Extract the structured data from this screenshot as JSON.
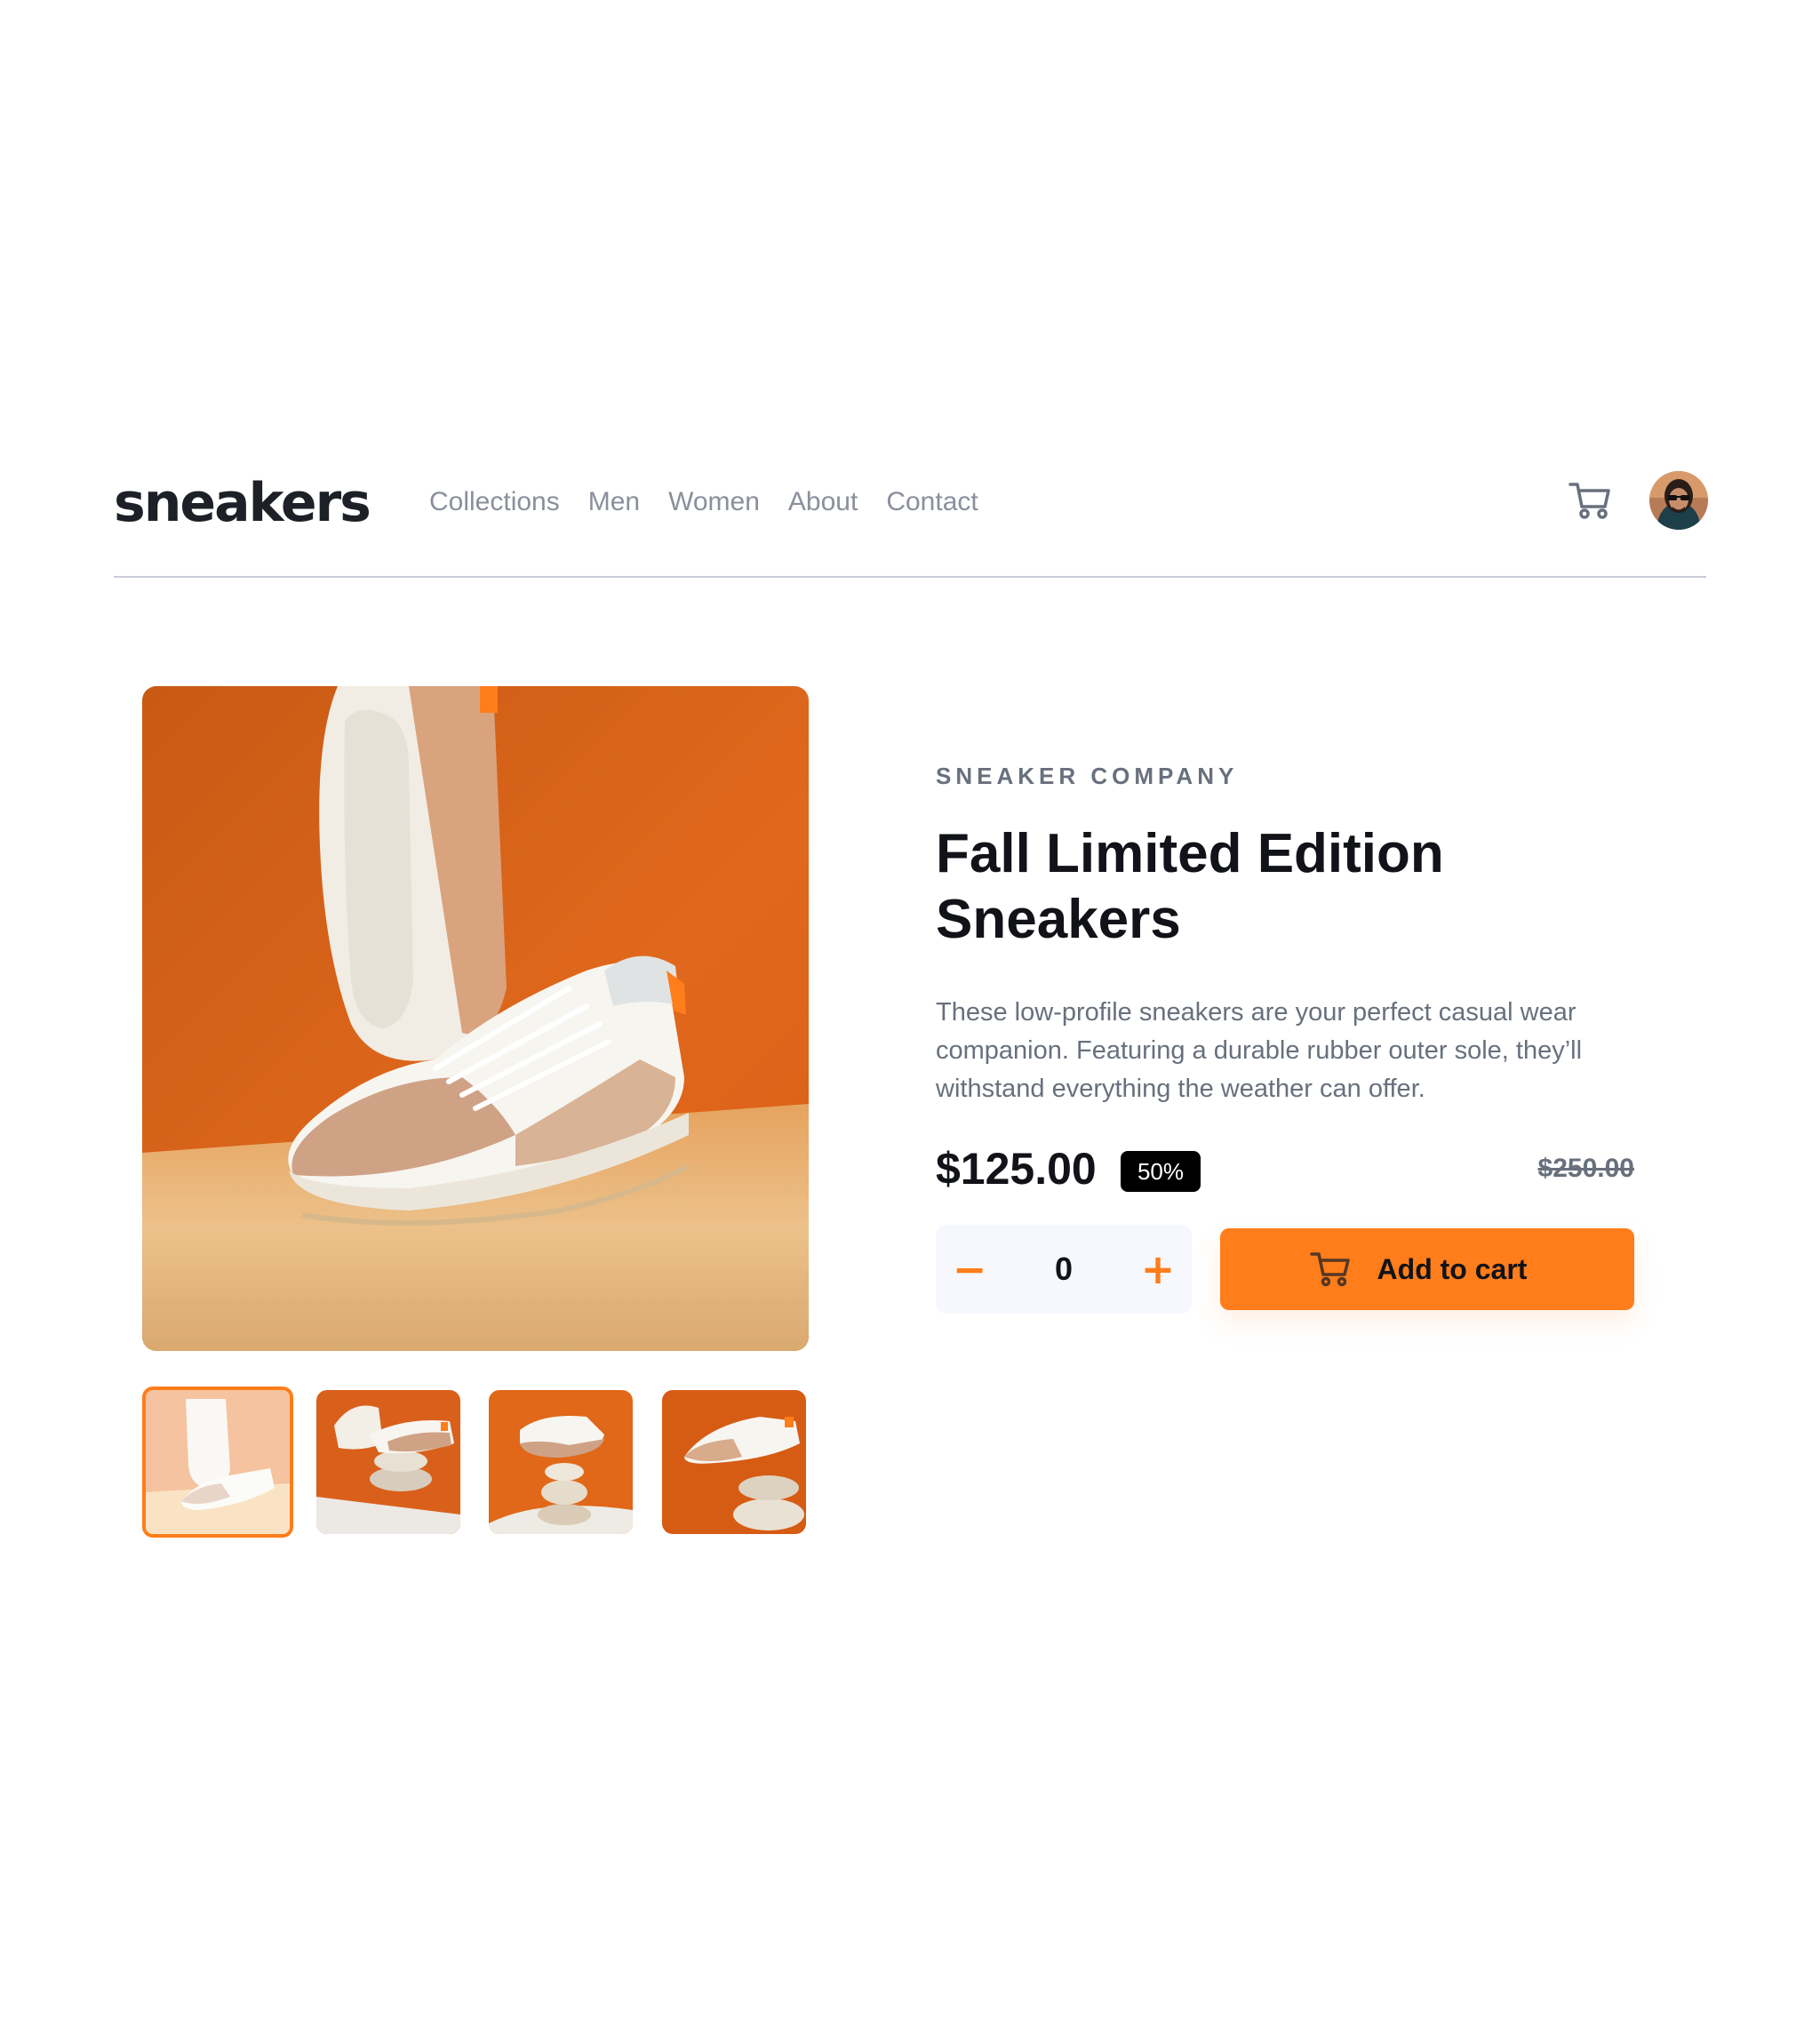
{
  "header": {
    "logo": "sneakers",
    "nav": [
      "Collections",
      "Men",
      "Women",
      "About",
      "Contact"
    ]
  },
  "product": {
    "company": "SNEAKER COMPANY",
    "title_line1": "Fall Limited Edition",
    "title_line2": "Sneakers",
    "description_line1": "These low-profile sneakers are your perfect casual wear",
    "description_line2": "companion. Featuring a durable rubber outer sole, they’ll",
    "description_line3": "withstand everything the weather can offer.",
    "price": "$125.00",
    "discount": "50%",
    "old_price": "$250.00"
  },
  "cart": {
    "quantity": "0",
    "minus_symbol": "−",
    "plus_symbol": "+",
    "add_label": "Add to cart"
  },
  "gallery": {
    "active_thumbnail": 1,
    "thumbnail_count": 4
  },
  "colors": {
    "accent": "#ff7d1a",
    "text_dark": "#111318",
    "text_muted": "#68707d",
    "qty_bg": "#f6f8fd"
  },
  "icons": {
    "cart": "cart-icon",
    "avatar": "avatar",
    "minus": "minus-icon",
    "plus": "plus-icon"
  }
}
